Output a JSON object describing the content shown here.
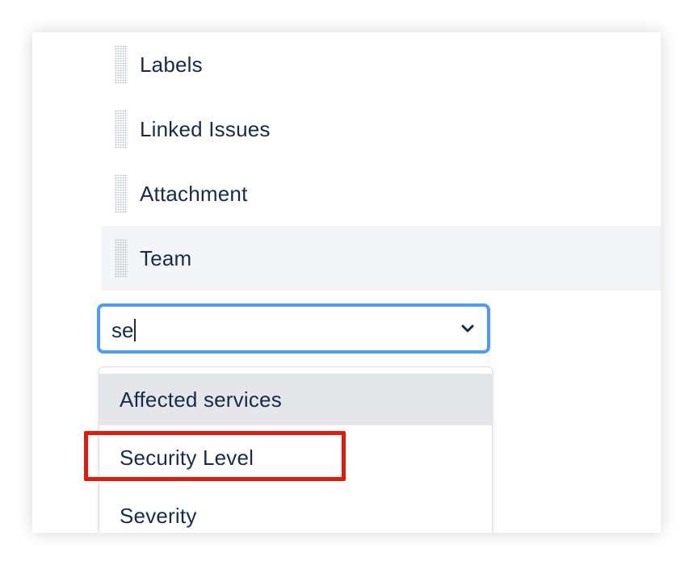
{
  "field_list": {
    "items": [
      {
        "label": "Labels"
      },
      {
        "label": "Linked Issues"
      },
      {
        "label": "Attachment"
      },
      {
        "label": "Team"
      }
    ]
  },
  "select": {
    "value": "se",
    "chevron_icon": "chevron-down-icon"
  },
  "dropdown": {
    "options": [
      {
        "label": "Affected services"
      },
      {
        "label": "Security Level"
      },
      {
        "label": "Severity"
      }
    ]
  },
  "colors": {
    "focus_border": "#4c9aff",
    "text": "#172b4d",
    "annotation": "#e21b0c",
    "highlight_row": "#f4f5f7",
    "active_option": "#e4e6ea"
  }
}
